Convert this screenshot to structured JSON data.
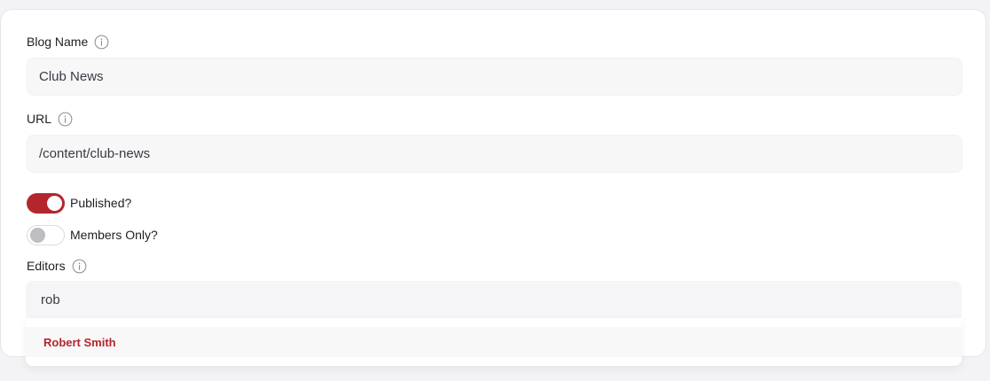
{
  "form": {
    "blog_name": {
      "label": "Blog Name",
      "value": "Club News"
    },
    "url": {
      "label": "URL",
      "value": "/content/club-news"
    },
    "published": {
      "label": "Published?",
      "checked": true
    },
    "members_only": {
      "label": "Members Only?",
      "checked": false
    },
    "editors": {
      "label": "Editors",
      "query": "rob",
      "suggestions": [
        "Robert Smith"
      ]
    }
  },
  "icons": {
    "info": "info-circle-icon"
  },
  "colors": {
    "accent": "#b3262d",
    "field_bg": "#f7f7f8",
    "page_bg": "#f3f3f5"
  }
}
